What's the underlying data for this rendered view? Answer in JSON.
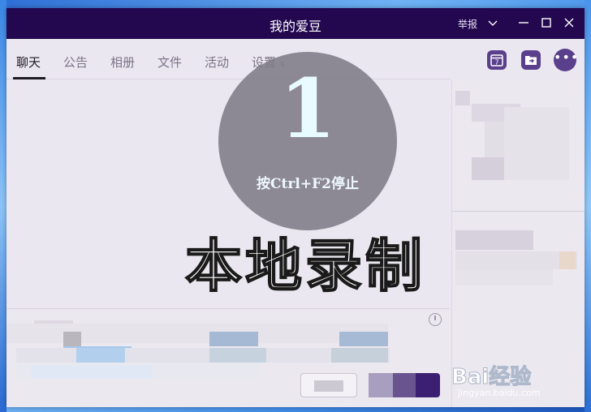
{
  "window": {
    "title": "我的爱豆",
    "report_label": "举报"
  },
  "tabs": [
    {
      "label": "聊天",
      "active": true
    },
    {
      "label": "公告"
    },
    {
      "label": "相册"
    },
    {
      "label": "文件"
    },
    {
      "label": "活动"
    },
    {
      "label": "设置"
    }
  ],
  "toolbar_right": {
    "calendar_icon_day": "7",
    "more_label": "•••"
  },
  "recording": {
    "countdown": "1",
    "hint": "按Ctrl+F2停止",
    "overlay_text": "本地录制"
  },
  "watermark": {
    "logo": "Bai经验",
    "url": "jingyan.baidu.com"
  },
  "colors": {
    "titlebar": "#23074f",
    "accent": "#5a3f8c",
    "send_button": "#3b1f72"
  }
}
